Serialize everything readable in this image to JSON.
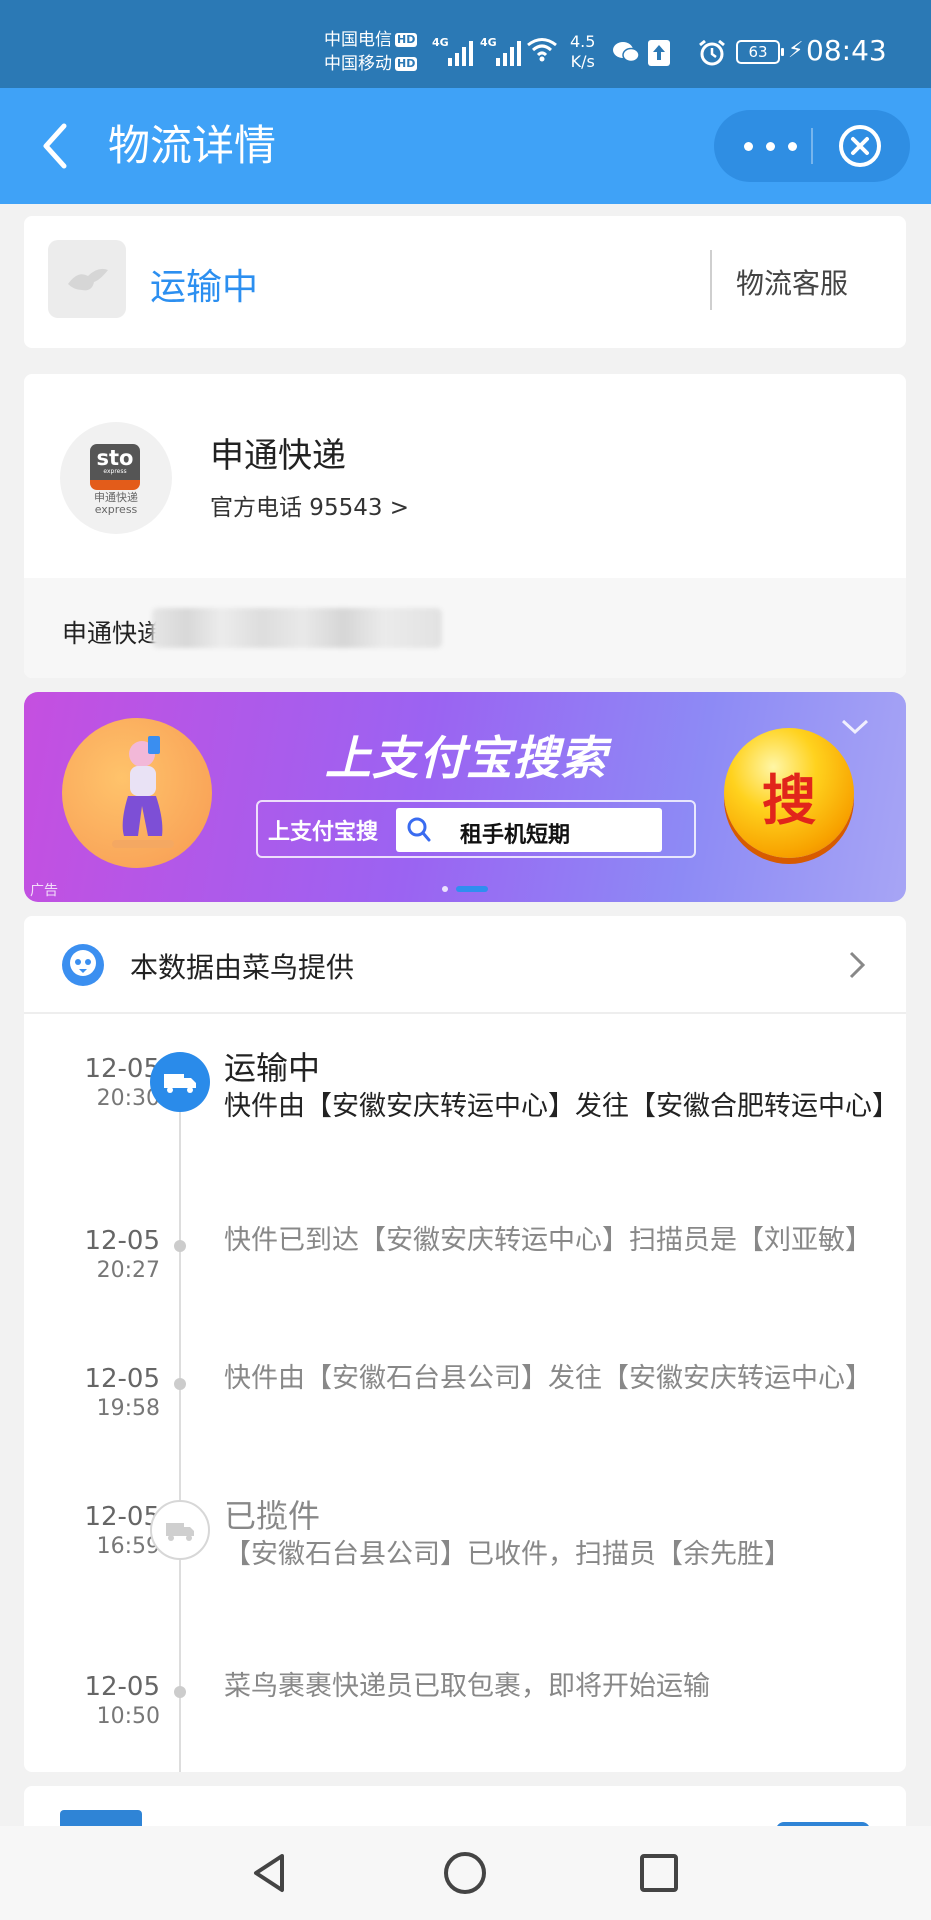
{
  "status_bar": {
    "carrier1": "中国电信",
    "carrier2": "中国移动",
    "hd": "HD",
    "network1": "4G",
    "network2": "4G",
    "speed_value": "4.5",
    "speed_unit": "K/s",
    "battery": "63",
    "time": "08:43"
  },
  "title_bar": {
    "title": "物流详情"
  },
  "status_card": {
    "status": "运输中",
    "service_label": "物流客服"
  },
  "courier": {
    "logo_text": "sto",
    "logo_sub": "express",
    "logo_cn": "申通快递",
    "logo_en": "express",
    "name": "申通快递",
    "phone": "官方电话 95543 >",
    "tracking_label": "申通快递"
  },
  "ad": {
    "headline": "上支付宝搜索",
    "search_label": "上支付宝搜",
    "search_keyword": "租手机短期",
    "button": "搜",
    "tag": "广告",
    "carousel_active_index": 1,
    "carousel_count": 2
  },
  "tracking": {
    "source": "本数据由菜鸟提供",
    "events": [
      {
        "date": "12-05",
        "time": "20:30",
        "title": "运输中",
        "desc": "快件由【安徽安庆转运中心】发往【安徽合肥转运中心】"
      },
      {
        "date": "12-05",
        "time": "20:27",
        "title": "",
        "desc": "快件已到达【安徽安庆转运中心】扫描员是【刘亚敏】"
      },
      {
        "date": "12-05",
        "time": "19:58",
        "title": "",
        "desc": "快件由【安徽石台县公司】发往【安徽安庆转运中心】"
      },
      {
        "date": "12-05",
        "time": "16:59",
        "title": "已揽件",
        "desc": "【安徽石台县公司】已收件，扫描员【余先胜】"
      },
      {
        "date": "12-05",
        "time": "10:50",
        "title": "",
        "desc": "菜鸟裹裹快递员已取包裹，即将开始运输"
      }
    ]
  },
  "icons": {
    "back": "chevron-left-icon",
    "more": "more-dots-icon",
    "close": "close-circle-icon",
    "truck": "truck-icon",
    "cainiao": "cainiao-bird-icon",
    "chevron": "chevron-right-icon",
    "search": "search-icon"
  },
  "colors": {
    "status_bar": "#2b79b5",
    "title_bar": "#3fa2f7",
    "accent": "#2c8ff0",
    "text_muted": "#777777"
  }
}
